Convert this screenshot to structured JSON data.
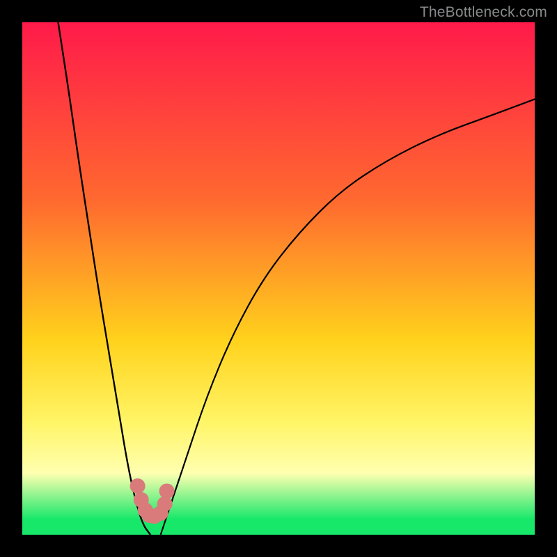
{
  "watermark": "TheBottleneck.com",
  "colors": {
    "top": "#ff1a4a",
    "upper_mid": "#ff6a2f",
    "mid": "#ffd21c",
    "lower_mid": "#fff566",
    "pale": "#ffffb0",
    "green": "#17e86a",
    "curve_stroke": "#000000",
    "marker": "#d97b7b",
    "frame": "#000000"
  },
  "chart_data": {
    "type": "line",
    "title": "",
    "xlabel": "",
    "ylabel": "",
    "xlim": [
      0,
      100
    ],
    "ylim": [
      0,
      100
    ],
    "series": [
      {
        "name": "left-curve",
        "x": [
          7,
          9,
          11,
          13,
          15,
          17,
          19,
          20.5,
          22,
          23.5,
          25
        ],
        "values": [
          100,
          87,
          73,
          60,
          47,
          35,
          23,
          14,
          7,
          2,
          0
        ]
      },
      {
        "name": "right-curve",
        "x": [
          27,
          29,
          32,
          36,
          41,
          47,
          54,
          62,
          71,
          81,
          92,
          100
        ],
        "values": [
          0,
          6,
          15,
          27,
          39,
          50,
          59,
          67,
          73,
          78,
          82,
          85
        ]
      }
    ],
    "markers": {
      "name": "highlight",
      "x": [
        22.5,
        23.2,
        24.0,
        24.8,
        25.8,
        27.0,
        27.8,
        28.2
      ],
      "values": [
        9.5,
        6.8,
        4.8,
        3.8,
        3.6,
        4.2,
        6.0,
        8.5
      ]
    },
    "gradient_stops": [
      {
        "pct": 0,
        "color": "top"
      },
      {
        "pct": 35,
        "color": "upper_mid"
      },
      {
        "pct": 62,
        "color": "mid"
      },
      {
        "pct": 78,
        "color": "lower_mid"
      },
      {
        "pct": 88,
        "color": "pale"
      },
      {
        "pct": 97,
        "color": "green"
      },
      {
        "pct": 100,
        "color": "green"
      }
    ]
  }
}
